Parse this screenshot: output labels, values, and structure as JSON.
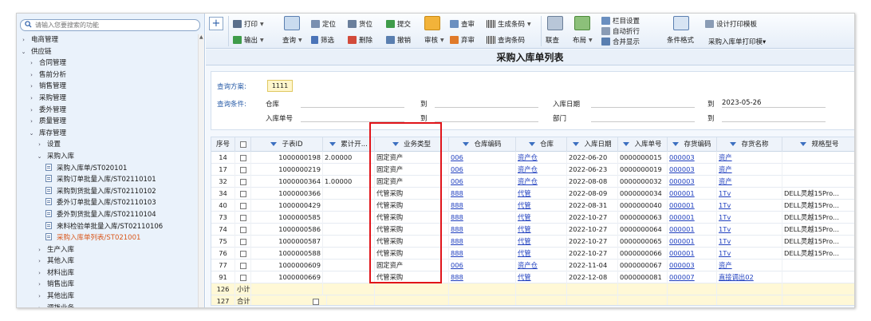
{
  "search": {
    "placeholder": "请输入您要搜索的功能"
  },
  "sidebar": {
    "items": [
      {
        "label": "电商管理",
        "level": 0,
        "arrow": ">"
      },
      {
        "label": "供应链",
        "level": 0,
        "arrow": "v"
      },
      {
        "label": "合同管理",
        "level": 1,
        "arrow": ">"
      },
      {
        "label": "售前分析",
        "level": 1,
        "arrow": ">"
      },
      {
        "label": "销售管理",
        "level": 1,
        "arrow": ">"
      },
      {
        "label": "采购管理",
        "level": 1,
        "arrow": ">"
      },
      {
        "label": "委外管理",
        "level": 1,
        "arrow": ">"
      },
      {
        "label": "质量管理",
        "level": 1,
        "arrow": ">"
      },
      {
        "label": "库存管理",
        "level": 1,
        "arrow": "v"
      },
      {
        "label": "设置",
        "level": 2,
        "arrow": ">"
      },
      {
        "label": "采购入库",
        "level": 2,
        "arrow": "v"
      },
      {
        "label": "采购入库单/ST020101",
        "level": 3,
        "arrow": "doc"
      },
      {
        "label": "采购订单批量入库/ST02110101",
        "level": 3,
        "arrow": "doc"
      },
      {
        "label": "采购到货批量入库/ST02110102",
        "level": 3,
        "arrow": "doc"
      },
      {
        "label": "委外订单批量入库/ST02110103",
        "level": 3,
        "arrow": "doc"
      },
      {
        "label": "委外到货批量入库/ST02110104",
        "level": 3,
        "arrow": "doc"
      },
      {
        "label": "来料检验单批量入库/ST02110106",
        "level": 3,
        "arrow": "doc"
      },
      {
        "label": "采购入库单列表/ST021001",
        "level": 3,
        "arrow": "doc",
        "active": true
      },
      {
        "label": "生产入库",
        "level": 2,
        "arrow": ">"
      },
      {
        "label": "其他入库",
        "level": 2,
        "arrow": ">"
      },
      {
        "label": "材料出库",
        "level": 2,
        "arrow": ">"
      },
      {
        "label": "销售出库",
        "level": 2,
        "arrow": ">"
      },
      {
        "label": "其他出库",
        "level": 2,
        "arrow": ">"
      },
      {
        "label": "调拨业务",
        "level": 2,
        "arrow": ">"
      }
    ]
  },
  "toolbar": {
    "print": "打印",
    "export": "输出",
    "query": "查询",
    "locate": "定位",
    "filter": "筛选",
    "goods_pos": "货位",
    "delete": "删除",
    "submit": "提交",
    "cancel": "撤销",
    "audit": "审核",
    "check": "查审",
    "abandon": "弃审",
    "gen_barcode": "生成条码",
    "query_barcode": "查询条码",
    "linked_query": "联查",
    "layout": "布局",
    "column_settings": "栏目设置",
    "auto_wrap": "自动折行",
    "merge_display": "合并显示",
    "conditional_format": "条件格式",
    "design_template": "设计打印模板",
    "print_template": "采购入库单打印模▾"
  },
  "page_title": "采购入库单列表",
  "query": {
    "scheme_label": "查询方案:",
    "scheme_value": "1111",
    "cond_label": "查询条件:",
    "warehouse": "仓库",
    "to1": "到",
    "in_date": "入库日期",
    "to2": "到",
    "date_to": "2023-05-26",
    "in_no": "入库单号",
    "to3": "到",
    "dept": "部门",
    "to4": "到"
  },
  "grid": {
    "headers": [
      "序号",
      "",
      "子表ID",
      "累计开...",
      "业务类型",
      "仓库编码",
      "仓库",
      "入库日期",
      "入库单号",
      "存货编码",
      "存货名称",
      "规格型号"
    ],
    "rows": [
      [
        "14",
        "",
        "1000000198",
        "2.00000",
        "固定资产",
        "006",
        "资产仓",
        "2022-06-20",
        "0000000015",
        "000003",
        "资产",
        ""
      ],
      [
        "17",
        "",
        "1000000219",
        "",
        "固定资产",
        "006",
        "资产仓",
        "2022-06-23",
        "0000000019",
        "000003",
        "资产",
        ""
      ],
      [
        "32",
        "",
        "1000000364",
        "1.00000",
        "固定资产",
        "006",
        "资产仓",
        "2022-08-08",
        "0000000032",
        "000003",
        "资产",
        ""
      ],
      [
        "34",
        "",
        "1000000366",
        "",
        "代管采购",
        "888",
        "代管",
        "2022-08-09",
        "0000000034",
        "000001",
        "1Tv",
        "DELL灵越15Pro..."
      ],
      [
        "40",
        "",
        "1000000429",
        "",
        "代管采购",
        "888",
        "代管",
        "2022-08-31",
        "0000000040",
        "000001",
        "1Tv",
        "DELL灵越15Pro..."
      ],
      [
        "73",
        "",
        "1000000585",
        "",
        "代管采购",
        "888",
        "代管",
        "2022-10-27",
        "0000000063",
        "000001",
        "1Tv",
        "DELL灵越15Pro..."
      ],
      [
        "74",
        "",
        "1000000586",
        "",
        "代管采购",
        "888",
        "代管",
        "2022-10-27",
        "0000000064",
        "000001",
        "1Tv",
        "DELL灵越15Pro..."
      ],
      [
        "75",
        "",
        "1000000587",
        "",
        "代管采购",
        "888",
        "代管",
        "2022-10-27",
        "0000000065",
        "000001",
        "1Tv",
        "DELL灵越15Pro..."
      ],
      [
        "76",
        "",
        "1000000588",
        "",
        "代管采购",
        "888",
        "代管",
        "2022-10-27",
        "0000000066",
        "000001",
        "1Tv",
        "DELL灵越15Pro..."
      ],
      [
        "77",
        "",
        "1000000609",
        "",
        "固定资产",
        "006",
        "资产仓",
        "2022-11-04",
        "0000000067",
        "000003",
        "资产",
        ""
      ],
      [
        "91",
        "",
        "1000000669",
        "",
        "代管采购",
        "888",
        "代管",
        "2022-12-08",
        "0000000081",
        "000007",
        "直接调出02",
        ""
      ]
    ],
    "subtotal": {
      "no": "126",
      "label": "小计"
    },
    "total": {
      "no": "127",
      "label": "合计"
    }
  },
  "colors": {
    "accent": "#2a5da8",
    "highlight": "#e0141a",
    "active": "#d9571b"
  }
}
